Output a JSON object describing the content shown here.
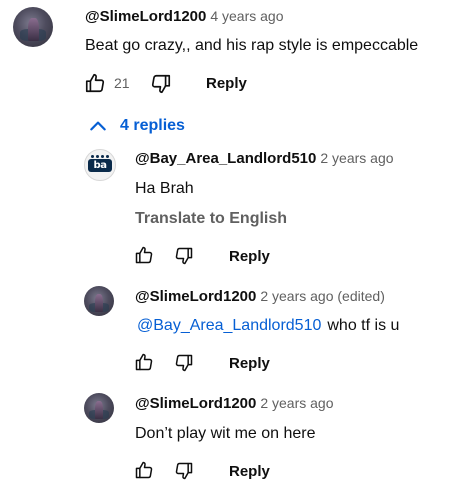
{
  "comment": {
    "author": "@SlimeLord1200",
    "time": "4 years ago",
    "text": "Beat go crazy,, and his rap style is empeccable",
    "likes": "21",
    "reply_label": "Reply"
  },
  "replies_toggle": {
    "label": "4 replies"
  },
  "replies": [
    {
      "author": "@Bay_Area_Landlord510",
      "time": "2 years ago",
      "text": "Ha Brah",
      "translate_label": "Translate to English",
      "reply_label": "Reply",
      "avatar_text": "ba"
    },
    {
      "author": "@SlimeLord1200",
      "time": "2 years ago (edited)",
      "mention": "@Bay_Area_Landlord510",
      "text": "who tf is u",
      "reply_label": "Reply"
    },
    {
      "author": "@SlimeLord1200",
      "time": "2 years ago",
      "text": "Don’t play wit me on here",
      "reply_label": "Reply"
    }
  ],
  "icons": {
    "like": "thumbs-up-icon",
    "dislike": "thumbs-down-icon",
    "toggle": "chevron-up-icon"
  },
  "colors": {
    "link_blue": "#065fd4",
    "secondary_text": "#606060",
    "primary_text": "#0f0f0f"
  }
}
